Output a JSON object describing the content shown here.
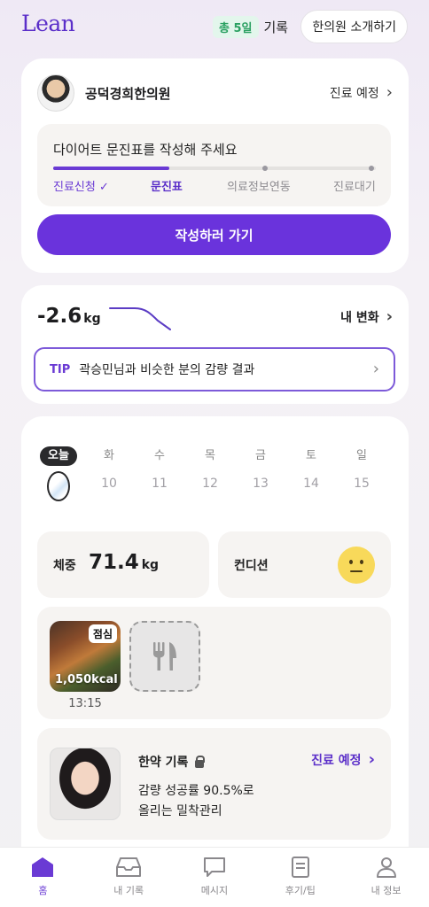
{
  "header": {
    "logo": "Lean",
    "streak_badge": "총 5일",
    "streak_label": "기록",
    "intro_button": "한의원 소개하기"
  },
  "clinic_card": {
    "clinic_name": "공덕경희한의원",
    "status_label": "진료 예정",
    "prompt": "다이어트 문진표를 작성해 주세요",
    "progress_fraction": 0.36,
    "steps": [
      {
        "label": "진료신청 ✓",
        "state": "done"
      },
      {
        "label": "문진표",
        "state": "current"
      },
      {
        "label": "의료정보연동",
        "state": "todo"
      },
      {
        "label": "진료대기",
        "state": "todo"
      }
    ],
    "cta_label": "작성하러 가기"
  },
  "change_card": {
    "weight_change": "-2.6",
    "weight_unit": "kg",
    "my_change_label": "내 변화",
    "tip_tag": "TIP",
    "tip_text": "곽승민님과 비슷한 분의 감량 결과"
  },
  "week": {
    "days": [
      {
        "name": "오늘",
        "num": "",
        "today": true
      },
      {
        "name": "화",
        "num": "10"
      },
      {
        "name": "수",
        "num": "11"
      },
      {
        "name": "목",
        "num": "12"
      },
      {
        "name": "금",
        "num": "13"
      },
      {
        "name": "토",
        "num": "14"
      },
      {
        "name": "일",
        "num": "15"
      }
    ]
  },
  "stats": {
    "weight_label": "체중",
    "weight_value": "71.4",
    "weight_unit": "kg",
    "condition_label": "컨디션",
    "condition_icon": "neutral-face-icon"
  },
  "meal": {
    "tag": "점심",
    "kcal": "1,050kcal",
    "time": "13:15",
    "add_icon": "fork-knife-icon"
  },
  "herbal": {
    "title": "한약 기록",
    "status": "진료 예정",
    "desc_line1": "감량 성공률 90.5%로",
    "desc_line2": "올리는 밀착관리"
  },
  "tabbar": {
    "tabs": [
      {
        "label": "홈",
        "icon": "home-icon",
        "active": true
      },
      {
        "label": "내 기록",
        "icon": "inbox-icon"
      },
      {
        "label": "메시지",
        "icon": "message-icon"
      },
      {
        "label": "후기/팁",
        "icon": "document-icon"
      },
      {
        "label": "내 정보",
        "icon": "person-icon"
      }
    ]
  },
  "colors": {
    "accent": "#6a33dc",
    "streak_green": "#2aa061",
    "condition_yellow": "#f8d95a"
  }
}
